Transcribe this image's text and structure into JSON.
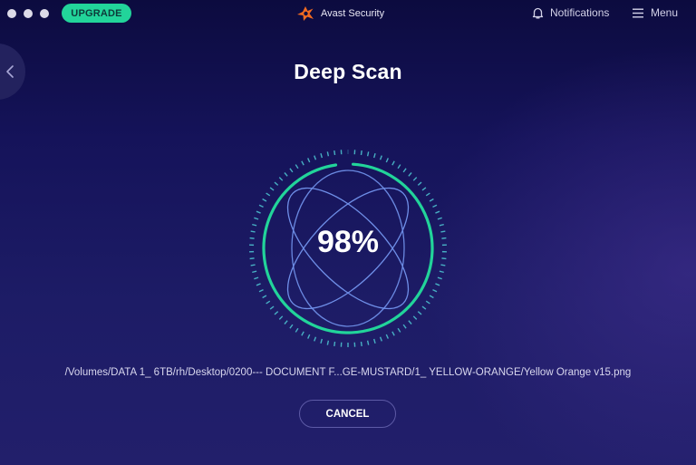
{
  "window": {
    "traffic_lights": [
      "close",
      "minimize",
      "zoom"
    ]
  },
  "header": {
    "upgrade_label": "UPGRADE",
    "app_name": "Avast Security",
    "logo_icon": "avast-logo-icon",
    "notifications_label": "Notifications",
    "notifications_icon": "bell-icon",
    "menu_label": "Menu",
    "menu_icon": "hamburger-icon"
  },
  "navigation": {
    "back_icon": "chevron-left-icon"
  },
  "scan": {
    "title": "Deep Scan",
    "progress_label": "98%",
    "progress_value": 98,
    "current_file": "/Volumes/DATA 1_ 6TB/rh/Desktop/0200---  DOCUMENT F...GE-MUSTARD/1_  YELLOW-ORANGE/Yellow Orange v15.png",
    "cancel_label": "CANCEL"
  },
  "colors": {
    "accent": "#22d49a",
    "background_top": "#0c0b3f",
    "background_bottom": "#221f6b",
    "orbit_lines": "#6f8fe8",
    "logo_orange": "#f26b21"
  }
}
